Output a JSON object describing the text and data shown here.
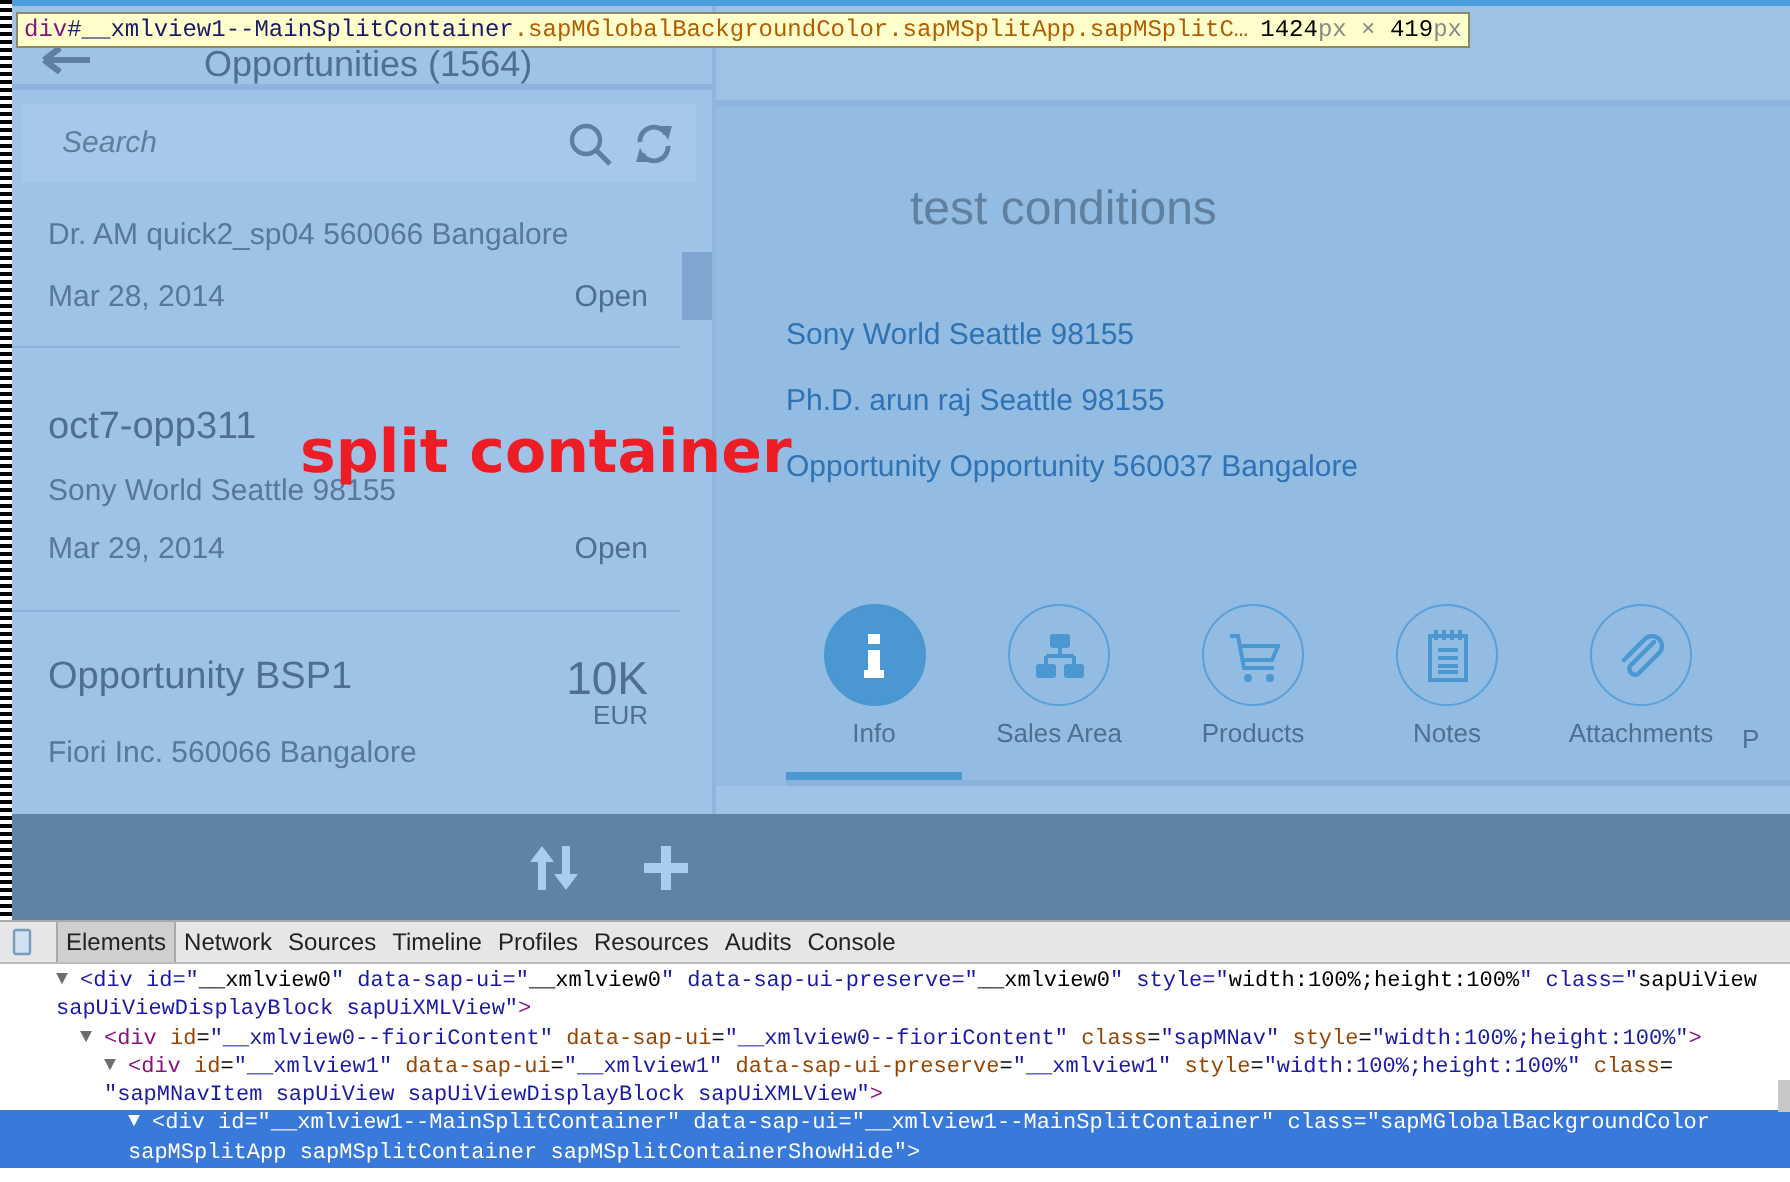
{
  "inspector_tooltip": {
    "selector": "div#__xmlview1--MainSplitContainer.sapMGlobalBackgroundColor.sapMSplitApp.sapMSplitC…",
    "size": "1424px × 419px"
  },
  "master": {
    "title": "Opportunities (1564)",
    "search": {
      "placeholder": "Search"
    },
    "items": [
      {
        "description": "Dr. AM quick2_sp04 560066 Bangalore",
        "date": "Mar 28, 2014",
        "status": "Open"
      },
      {
        "title": "oct7-opp311",
        "description": "Sony World Seattle 98155",
        "date": "Mar 29, 2014",
        "status": "Open"
      },
      {
        "title": "Opportunity BSP1",
        "amount": "10K",
        "currency": "EUR",
        "description": "Fiori Inc. 560066 Bangalore"
      }
    ]
  },
  "detail": {
    "heading": "test conditions",
    "links": [
      "Sony World Seattle 98155",
      "Ph.D. arun raj Seattle 98155",
      "Opportunity Opportunity 560037 Bangalore"
    ],
    "icon_tabs": [
      {
        "label": "Info",
        "selected": true
      },
      {
        "label": "Sales Area",
        "selected": false
      },
      {
        "label": "Products",
        "selected": false
      },
      {
        "label": "Notes",
        "selected": false
      },
      {
        "label": "Attachments",
        "selected": false
      },
      {
        "label": "P",
        "selected": false
      }
    ]
  },
  "annotation": "split container",
  "devtools": {
    "tabs": [
      {
        "label": "Elements",
        "selected": true
      },
      {
        "label": "Network",
        "selected": false
      },
      {
        "label": "Sources",
        "selected": false
      },
      {
        "label": "Timeline",
        "selected": false
      },
      {
        "label": "Profiles",
        "selected": false
      },
      {
        "label": "Resources",
        "selected": false
      },
      {
        "label": "Audits",
        "selected": false
      },
      {
        "label": "Console",
        "selected": false
      }
    ],
    "nodes": [
      {
        "toggle": "▼",
        "lines": [
          "<div id=\"__xmlview0\" data-sap-ui=\"__xmlview0\" data-sap-ui-preserve=\"__xmlview0\" style=\"width:100%;height:100%\" class=\"sapUiView",
          "sapUiViewDisplayBlock sapUiXMLView\">"
        ],
        "selected": false,
        "children": [
          {
            "toggle": "▼",
            "lines": [
              "<div id=\"__xmlview0--fioriContent\" data-sap-ui=\"__xmlview0--fioriContent\" class=\"sapMNav\" style=\"width:100%;height:100%\">"
            ],
            "selected": false,
            "children": [
              {
                "toggle": "▼",
                "lines": [
                  "<div id=\"__xmlview1\" data-sap-ui=\"__xmlview1\" data-sap-ui-preserve=\"__xmlview1\" style=\"width:100%;height:100%\" class=",
                  "\"sapMNavItem sapUiView sapUiViewDisplayBlock sapUiXMLView\">"
                ],
                "selected": false,
                "children": [
                  {
                    "toggle": "▼",
                    "lines": [
                      "<div id=\"__xmlview1--MainSplitContainer\" data-sap-ui=\"__xmlview1--MainSplitContainer\" class=\"sapMGlobalBackgroundColor",
                      "sapMSplitApp sapMSplitContainer sapMSplitContainerShowHide\">"
                    ],
                    "selected": true
                  }
                ]
              }
            ]
          }
        ]
      }
    ]
  }
}
